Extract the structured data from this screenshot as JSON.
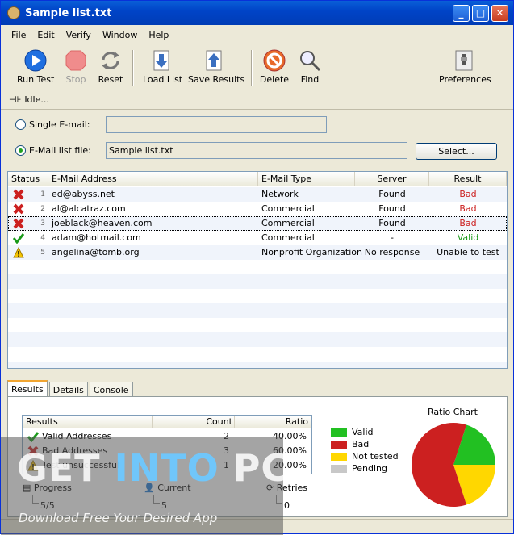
{
  "window": {
    "title": "Sample list.txt"
  },
  "menu": [
    "File",
    "Edit",
    "Verify",
    "Window",
    "Help"
  ],
  "toolbar": {
    "run": "Run Test",
    "stop": "Stop",
    "reset": "Reset",
    "load": "Load List",
    "save": "Save Results",
    "delete": "Delete",
    "find": "Find",
    "prefs": "Preferences"
  },
  "status": {
    "text": "Idle..."
  },
  "form": {
    "single_label": "Single E-mail:",
    "single_value": "",
    "list_label": "E-Mail list file:",
    "list_value": "Sample list.txt",
    "select_button": "Select..."
  },
  "grid": {
    "columns": [
      "Status",
      "E-Mail Address",
      "E-Mail Type",
      "Server",
      "Result"
    ],
    "rows": [
      {
        "status": "bad",
        "num": "1",
        "email": "ed@abyss.net",
        "type": "Network",
        "server": "Found",
        "result": "Bad"
      },
      {
        "status": "bad",
        "num": "2",
        "email": "al@alcatraz.com",
        "type": "Commercial",
        "server": "Found",
        "result": "Bad"
      },
      {
        "status": "bad",
        "num": "3",
        "email": "joeblack@heaven.com",
        "type": "Commercial",
        "server": "Found",
        "result": "Bad"
      },
      {
        "status": "valid",
        "num": "4",
        "email": "adam@hotmail.com",
        "type": "Commercial",
        "server": "-",
        "result": "Valid"
      },
      {
        "status": "warn",
        "num": "5",
        "email": "angelina@tomb.org",
        "type": "Nonprofit Organization",
        "server": "No response",
        "result": "Unable to test"
      }
    ]
  },
  "tabs": [
    "Results",
    "Details",
    "Console"
  ],
  "results": {
    "headers": [
      "Results",
      "Count",
      "Ratio"
    ],
    "rows": [
      {
        "label": "Valid Addresses",
        "count": "2",
        "ratio": "40.00%",
        "icon": "valid"
      },
      {
        "label": "Bad Addresses",
        "count": "3",
        "ratio": "60.00%",
        "icon": "bad"
      },
      {
        "label": "Test unsuccessful",
        "count": "1",
        "ratio": "20.00%",
        "icon": "warn"
      }
    ]
  },
  "counters": {
    "progress_label": "Progress",
    "progress_value": "5/5",
    "current_label": "Current",
    "current_value": "5",
    "retries_label": "Retries",
    "retries_value": "0"
  },
  "chart_data": {
    "type": "pie",
    "title": "Ratio Chart",
    "legend": [
      "Valid",
      "Bad",
      "Not tested",
      "Pending"
    ],
    "colors": {
      "Valid": "#22c022",
      "Bad": "#cc2020",
      "Not tested": "#ffd700",
      "Pending": "#c8c8c8"
    },
    "values": [
      {
        "name": "Valid",
        "value": 20
      },
      {
        "name": "Bad",
        "value": 60
      },
      {
        "name": "Not tested",
        "value": 20
      },
      {
        "name": "Pending",
        "value": 0
      }
    ]
  },
  "watermark": {
    "title_a": "GET ",
    "title_b": "INTO",
    "title_c": " PC",
    "subtitle": "Download Free Your Desired App"
  },
  "colors": {
    "bad": "#cc2020",
    "valid": "#1a9a1a",
    "accent": "#0a5fd8"
  }
}
